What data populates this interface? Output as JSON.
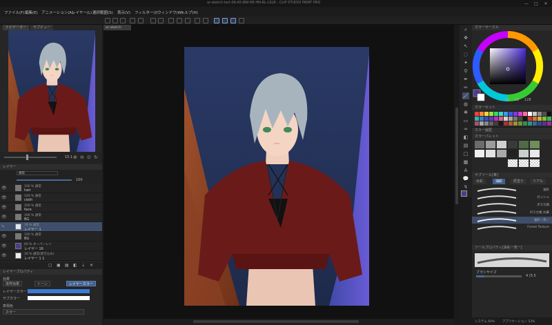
{
  "window": {
    "title": "ar-sketch-tart-06-A5-BW-HE-HN-RL-LSLR - CLIP STUDIO PAINT PRO",
    "min": "—",
    "max": "□",
    "close": "✕"
  },
  "menu": [
    "ファイル(F)",
    "編集(E)",
    "アニメーション(A)",
    "レイヤー(L)",
    "選択範囲(S)",
    "表示(V)",
    "フィルター(I)",
    "ウィンドウ(W)",
    "ヘルプ(H)"
  ],
  "navigator": {
    "tabs": [
      "ナビゲーター",
      "サブビュー"
    ],
    "zoom": "15.1",
    "angle": "0.0"
  },
  "layers": {
    "header": "レイヤー",
    "blend_mode": "通常",
    "opacity": "100",
    "rows": [
      {
        "mode": "100 % 通常",
        "name": "hair"
      },
      {
        "mode": "100 % 通常",
        "name": "cloth"
      },
      {
        "mode": "100 % 通常",
        "name": "face"
      },
      {
        "mode": "100 % 通常",
        "name": "BG"
      },
      {
        "mode": "30 % 通常",
        "name": "レイヤー 1"
      },
      {
        "mode": "100 % 通常",
        "name": "BG"
      },
      {
        "mode": "60 % オーバーレイ",
        "name": "レイヤー 16"
      },
      {
        "mode": "30 % 通常(焼き込み)",
        "name": "レイヤー 1 1"
      }
    ]
  },
  "layer_property": {
    "header": "レイヤープロパティ",
    "effect_label": "効果",
    "btn_border": "境界効果",
    "btn_tone": "トーン",
    "btn_layer_color": "レイヤーカラー",
    "layer_color_label": "レイヤーカラー",
    "sub_color_label": "サブカラー",
    "expression_label": "表現色",
    "expression_value": "カラー"
  },
  "canvas": {
    "tab": "ar-sketch"
  },
  "color": {
    "header": "カラーサークル",
    "h": "62",
    "s": "89",
    "v": "128",
    "main_color": "#4a3d8c",
    "sub_color": "#ffffff",
    "swatch_header": "カラーセット",
    "palette_header": "カラーパレット",
    "history_header": "カラー履歴"
  },
  "subtool": {
    "header": "サブツール[筆]",
    "tabs": [
      "水彩",
      "油彩",
      "厚塗り",
      "リアル"
    ],
    "brushes": [
      "油彩",
      "ガッシュ",
      "ポスカ風",
      "ポスカ風 丸筆",
      "油彩ー荒ー",
      "Forest Texture"
    ]
  },
  "tool_property": {
    "header": "ツールプロパティ[油彩ー荒ー]",
    "brush_size_label": "ブラシサイズ",
    "brush_size_value": "4 (5.5"
  },
  "status": {
    "system": "システム 60%",
    "app": "アプリケーション 53%"
  }
}
